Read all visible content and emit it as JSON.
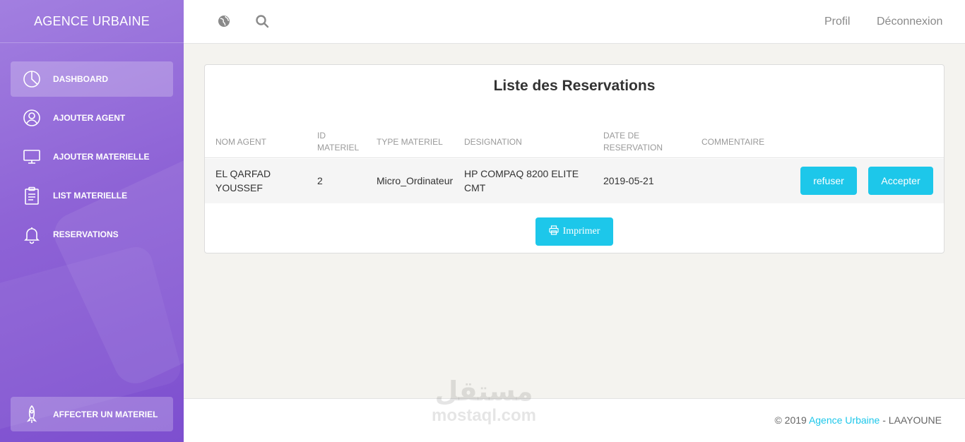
{
  "sidebar": {
    "brand": "AGENCE URBAINE",
    "items": [
      {
        "label": "DASHBOARD",
        "icon": "pie-chart-icon",
        "active": true
      },
      {
        "label": "AJOUTER AGENT",
        "icon": "user-icon",
        "active": false
      },
      {
        "label": "AJOUTER MATERIELLE",
        "icon": "monitor-icon",
        "active": false
      },
      {
        "label": "LIST MATERIELLE",
        "icon": "clipboard-icon",
        "active": false
      },
      {
        "label": "RESERVATIONS",
        "icon": "bell-icon",
        "active": false
      }
    ],
    "bottom_item": {
      "label": "AFFECTER UN MATERIEL",
      "icon": "rocket-icon"
    }
  },
  "topbar": {
    "icons": [
      "globe-icon",
      "search-icon"
    ],
    "profile_label": "Profil",
    "logout_label": "Déconnexion"
  },
  "main": {
    "title": "Liste des Reservations",
    "columns": [
      "NOM AGENT",
      "ID MATERIEL",
      "TYPE MATERIEL",
      "DESIGNATION",
      "DATE DE RESERVATION",
      "COMMENTAIRE"
    ],
    "rows": [
      {
        "nom_agent": "EL QARFAD YOUSSEF",
        "id_materiel": "2",
        "type_materiel": "Micro_Ordinateur",
        "designation": "HP COMPAQ 8200 ELITE CMT",
        "date_reservation": "2019-05-21",
        "commentaire": "",
        "refuse_label": "refuser",
        "accept_label": "Accepter"
      }
    ],
    "print_label": "Imprimer"
  },
  "footer": {
    "copyright": "© 2019",
    "link": "Agence Urbaine",
    "suffix": "- LAAYOUNE"
  },
  "watermark": {
    "arabic": "مستقل",
    "latin": "mostaql.com"
  },
  "colors": {
    "accent": "#1dc7ea",
    "sidebar_top": "#a27fe0",
    "sidebar_bottom": "#7d4fcf"
  }
}
